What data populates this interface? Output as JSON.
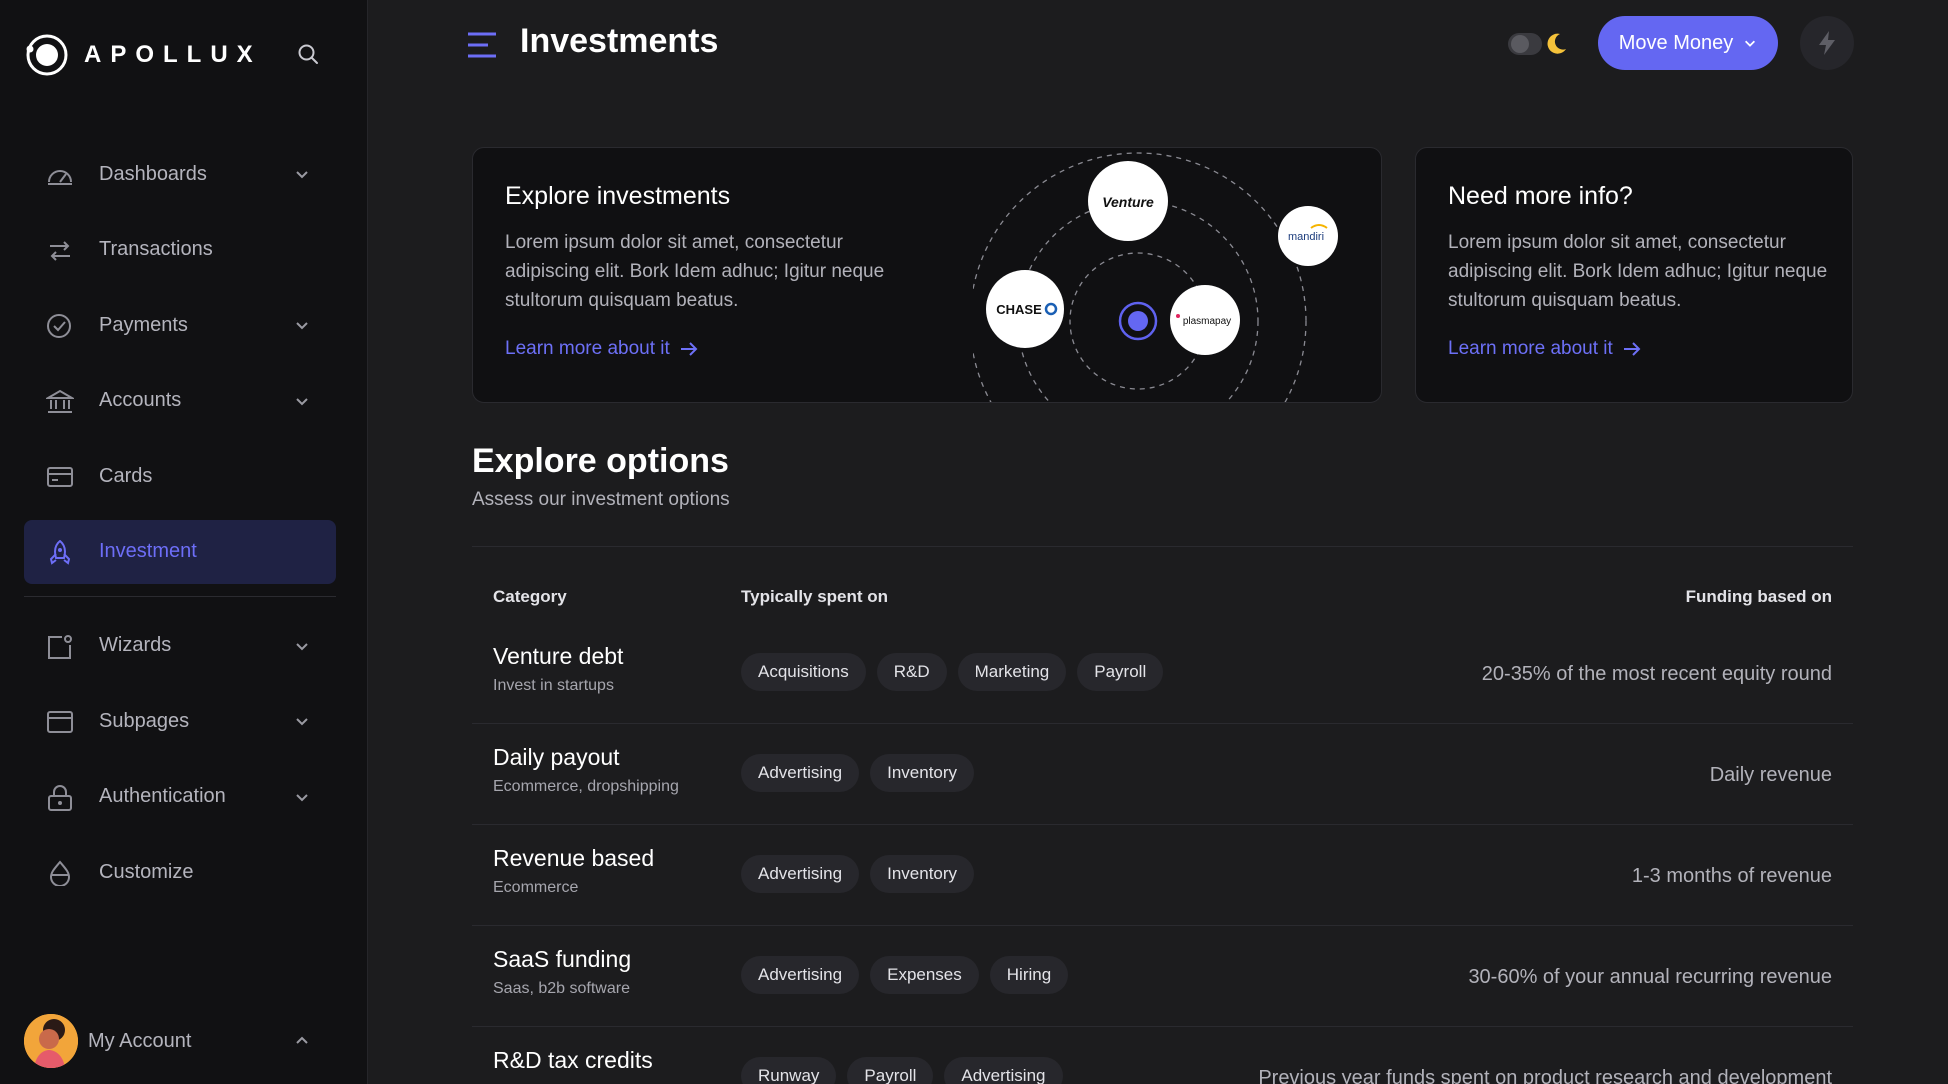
{
  "brand": {
    "name": "APOLLUX"
  },
  "sidebar": {
    "items": [
      {
        "label": "Dashboards",
        "icon": "gauge-icon",
        "has_chevron": true
      },
      {
        "label": "Transactions",
        "icon": "arrows-swap-icon",
        "has_chevron": false
      },
      {
        "label": "Payments",
        "icon": "check-circle-icon",
        "has_chevron": true
      },
      {
        "label": "Accounts",
        "icon": "bank-icon",
        "has_chevron": true
      },
      {
        "label": "Cards",
        "icon": "card-icon",
        "has_chevron": false
      },
      {
        "label": "Investment",
        "icon": "rocket-icon",
        "has_chevron": false,
        "active": true
      },
      {
        "label": "Wizards",
        "icon": "wizard-icon",
        "has_chevron": true
      },
      {
        "label": "Subpages",
        "icon": "window-icon",
        "has_chevron": true
      },
      {
        "label": "Authentication",
        "icon": "lock-icon",
        "has_chevron": true
      },
      {
        "label": "Customize",
        "icon": "drop-icon",
        "has_chevron": false
      }
    ],
    "account_label": "My Account"
  },
  "header": {
    "title": "Investments",
    "move_money_label": "Move Money"
  },
  "cards": {
    "explore": {
      "title": "Explore investments",
      "body": "Lorem ipsum dolor sit amet, consectetur adipiscing elit. Bork Idem adhuc; Igitur neque stultorum quisquam beatus.",
      "link": "Learn more about it",
      "logos": [
        "Venture",
        "mandiri",
        "CHASE",
        "plasmapay"
      ]
    },
    "info": {
      "title": "Need more info?",
      "body": "Lorem ipsum dolor sit amet, consectetur adipiscing elit. Bork Idem adhuc; Igitur neque stultorum quisquam beatus.",
      "link": "Learn more about it"
    }
  },
  "options": {
    "title": "Explore options",
    "subtitle": "Assess our investment options",
    "headers": {
      "category": "Category",
      "spent": "Typically spent on",
      "funding": "Funding based on"
    },
    "rows": [
      {
        "name": "Venture debt",
        "desc": "Invest in startups",
        "tags": [
          "Acquisitions",
          "R&D",
          "Marketing",
          "Payroll"
        ],
        "funding": "20-35% of the most recent equity round"
      },
      {
        "name": "Daily payout",
        "desc": "Ecommerce, dropshipping",
        "tags": [
          "Advertising",
          "Inventory"
        ],
        "funding": "Daily revenue"
      },
      {
        "name": "Revenue based",
        "desc": "Ecommerce",
        "tags": [
          "Advertising",
          "Inventory"
        ],
        "funding": "1-3 months of revenue"
      },
      {
        "name": "SaaS funding",
        "desc": "Saas, b2b software",
        "tags": [
          "Advertising",
          "Expenses",
          "Hiring"
        ],
        "funding": "30-60% of your annual recurring revenue"
      },
      {
        "name": "R&D tax credits",
        "desc": "",
        "tags": [
          "Runway",
          "Payroll",
          "Advertising"
        ],
        "funding": "Previous year funds spent on product research and development"
      }
    ]
  },
  "colors": {
    "accent": "#6467f2",
    "active_bg": "#1f2244",
    "moon": "#f5c23a"
  }
}
